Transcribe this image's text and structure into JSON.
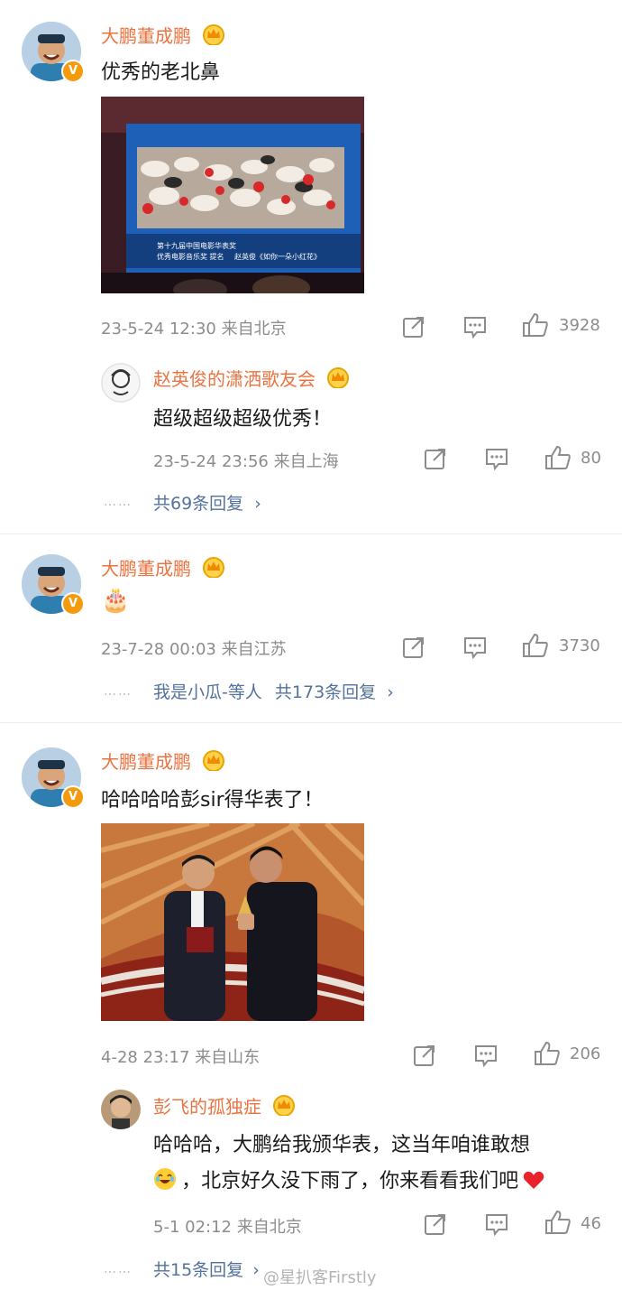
{
  "comments": [
    {
      "user": "大鹏董成鹏",
      "text": "优秀的老北鼻",
      "meta": "23-5-24 12:30  来自北京",
      "likes": "3928",
      "image": {
        "screen_title_line1": "第十九届中国电影华表奖",
        "screen_title_line2": "优秀电影音乐奖 提名",
        "screen_title_right": "赵英俊《如你一朵小红花》"
      },
      "reply": {
        "user": "赵英俊的潇洒歌友会",
        "text": "超级超级超级优秀！",
        "meta": "23-5-24 23:56  来自上海",
        "likes": "80"
      },
      "more": "共69条回复"
    },
    {
      "user": "大鹏董成鹏",
      "text": "🎂",
      "meta": "23-7-28 00:03  来自江苏",
      "likes": "3730",
      "more_prefix": "我是小瓜-等人",
      "more": "共173条回复"
    },
    {
      "user": "大鹏董成鹏",
      "text": "哈哈哈哈彭sir得华表了！",
      "meta": "4-28 23:17  来自山东",
      "likes": "206",
      "reply": {
        "user": "彭飞的孤独症",
        "text_line1": "哈哈哈，大鹏给我颁华表，这当年咱谁敢想",
        "text_line2": "，北京好久没下雨了，你来看看我们吧",
        "meta": "5-1 02:12  来自北京",
        "likes": "46"
      },
      "more": "共15条回复"
    }
  ],
  "watermark": "@星扒客Firstly",
  "icons": {
    "repost": "repost-icon",
    "comment": "comment-icon",
    "like": "like-icon",
    "crown": "crown-badge-icon",
    "verified": "verified-v-icon",
    "chevron": "chevron-right-icon"
  },
  "colors": {
    "username": "#eb7340",
    "link": "#53729c",
    "meta": "#8c8c8c",
    "badge": "#f59a0d"
  },
  "verified_mark": "V",
  "chevron_glyph": "›"
}
